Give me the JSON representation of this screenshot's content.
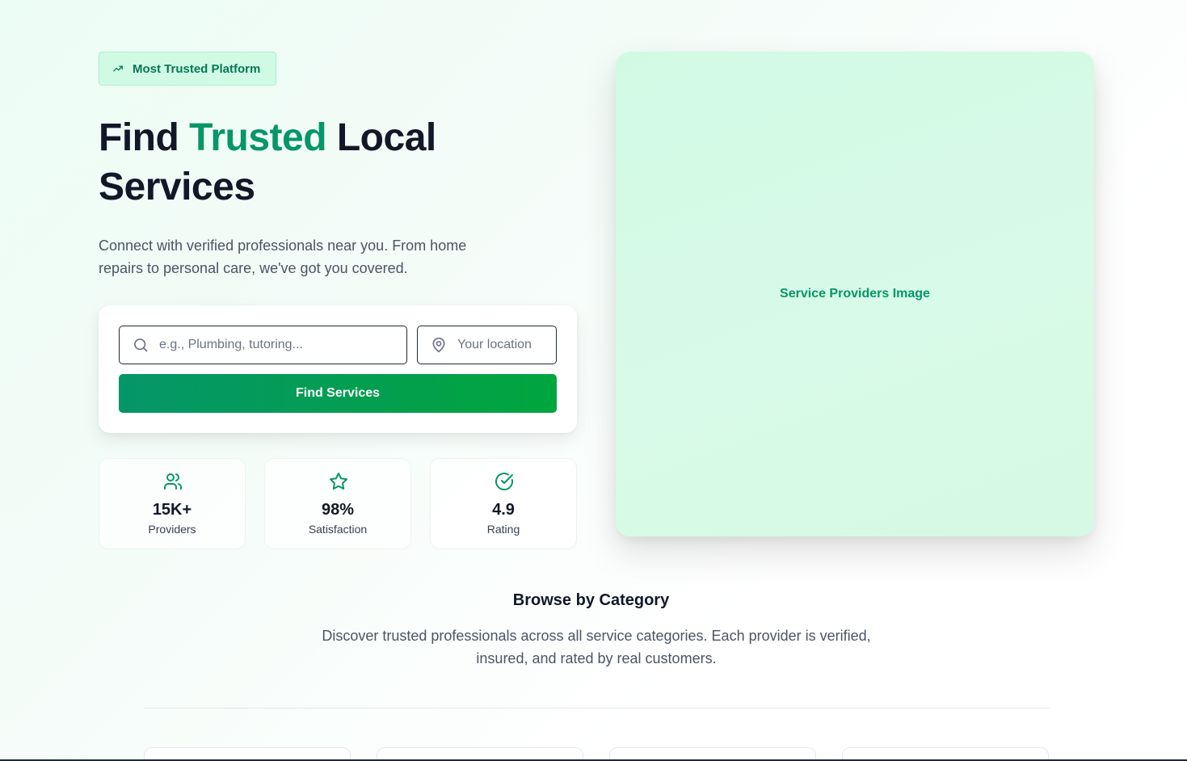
{
  "hero": {
    "badge": {
      "label": "Most Trusted Platform",
      "icon": "trending-up-icon"
    },
    "headline": {
      "part1": "Find ",
      "accent": "Trusted",
      "part2": " Local Services"
    },
    "subtext": "Connect with verified professionals near you. From home repairs to personal care, we've got you covered.",
    "search": {
      "service_placeholder": "e.g., Plumbing, tutoring...",
      "location_placeholder": "Your location",
      "button_label": "Find Services"
    },
    "stats": [
      {
        "icon": "users-icon",
        "value": "15K+",
        "label": "Providers"
      },
      {
        "icon": "star-icon",
        "value": "98%",
        "label": "Satisfaction"
      },
      {
        "icon": "check-circle-icon",
        "value": "4.9",
        "label": "Rating"
      }
    ],
    "image_placeholder": "Service Providers Image"
  },
  "category": {
    "title": "Browse by Category",
    "description": "Discover trusted professionals across all service categories. Each provider is verified, insured, and rated by real customers."
  },
  "colors": {
    "accent": "#059669",
    "badge_bg": "#d1fae5",
    "button_start": "#059669",
    "button_end": "#00a63e",
    "text_dark": "#111827",
    "text_muted": "#4b5563"
  }
}
